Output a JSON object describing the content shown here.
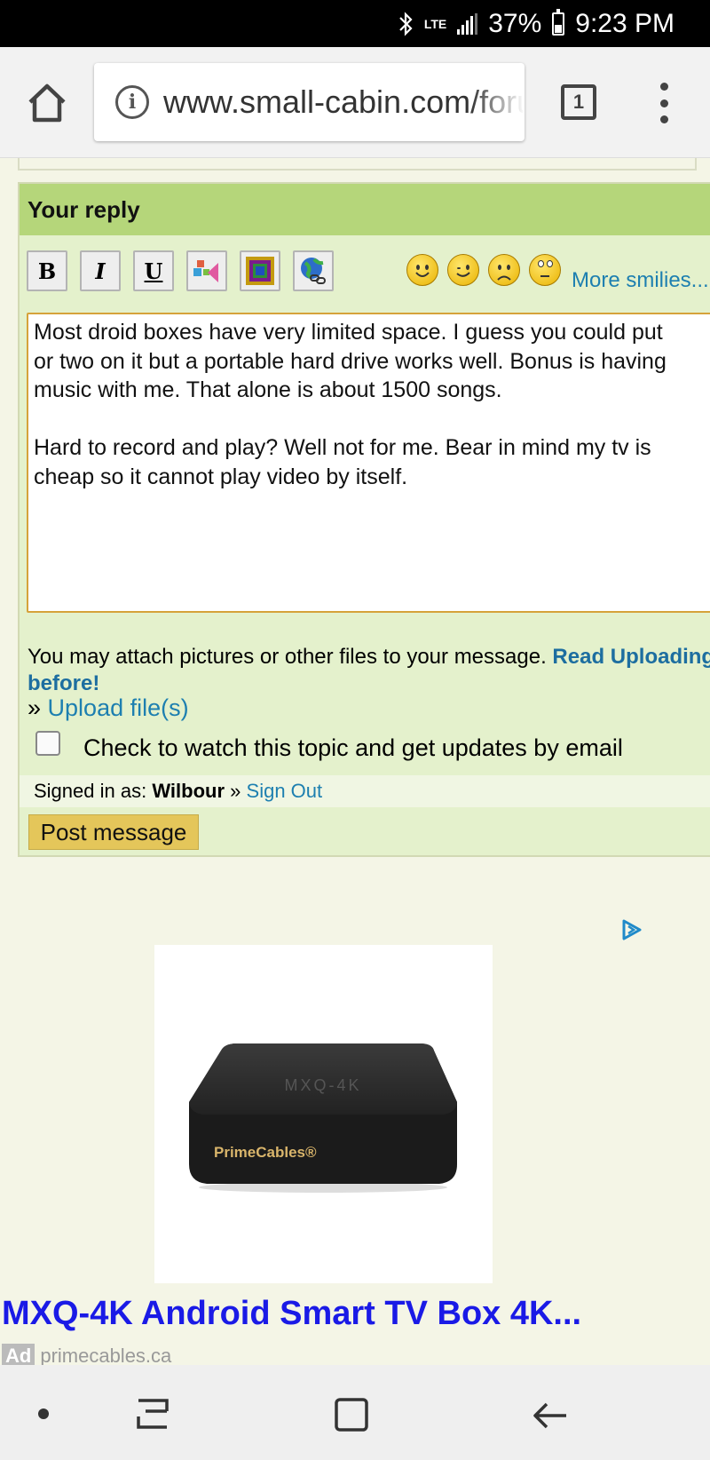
{
  "status_bar": {
    "network": "LTE",
    "battery": "37%",
    "time": "9:23 PM"
  },
  "browser": {
    "url": "www.small-cabin.com/forum",
    "tab_count": "1"
  },
  "reply": {
    "header": "Your reply",
    "toolbar": {
      "bold": "B",
      "italic": "I",
      "underline": "U",
      "more_smilies": "More smilies..."
    },
    "message": "Most droid boxes have very limited space. I guess you could put\nor two on it but a portable hard drive works well. Bonus is having\nmusic with me. That alone is about 1500 songs.\n\nHard to record and play? Well not for me. Bear in mind my tv is\ncheap so it cannot play video by itself.",
    "attach_text": "You may attach pictures or other files to your message.",
    "read_link": "Read Uploading before!",
    "upload_prefix": "»",
    "upload_link": "Upload file(s)",
    "watch_label": "Check to watch this topic and get updates by email",
    "signed_in_prefix": "Signed in as:",
    "username": "Wilbour",
    "sign_out_prefix": "»",
    "sign_out": "Sign Out",
    "post_button": "Post message"
  },
  "ad": {
    "product_model": "MXQ-4K",
    "product_brand": "PrimeCables®",
    "title": "MXQ-4K Android Smart TV Box 4K...",
    "badge": "Ad",
    "source": "primecables.ca"
  },
  "colors": {
    "header_green": "#b5d67a",
    "panel_green": "#e4f1cc",
    "link_blue": "#1d7fb0",
    "ad_title_blue": "#1a1ae6",
    "post_button_gold": "#e4c65a"
  },
  "icons": {
    "status": [
      "bluetooth-icon",
      "lte-icon",
      "signal-icon",
      "battery-icon"
    ],
    "browser": [
      "home-icon",
      "info-icon",
      "tabs-icon",
      "overflow-menu-icon"
    ],
    "toolbar": [
      "bold-icon",
      "italic-icon",
      "underline-icon",
      "color-icon",
      "image-icon",
      "link-icon",
      "smile-icon",
      "wink-icon",
      "sad-icon",
      "eyeroll-icon"
    ],
    "nav": [
      "dot-icon",
      "recents-icon",
      "home-square-icon",
      "back-icon"
    ]
  }
}
